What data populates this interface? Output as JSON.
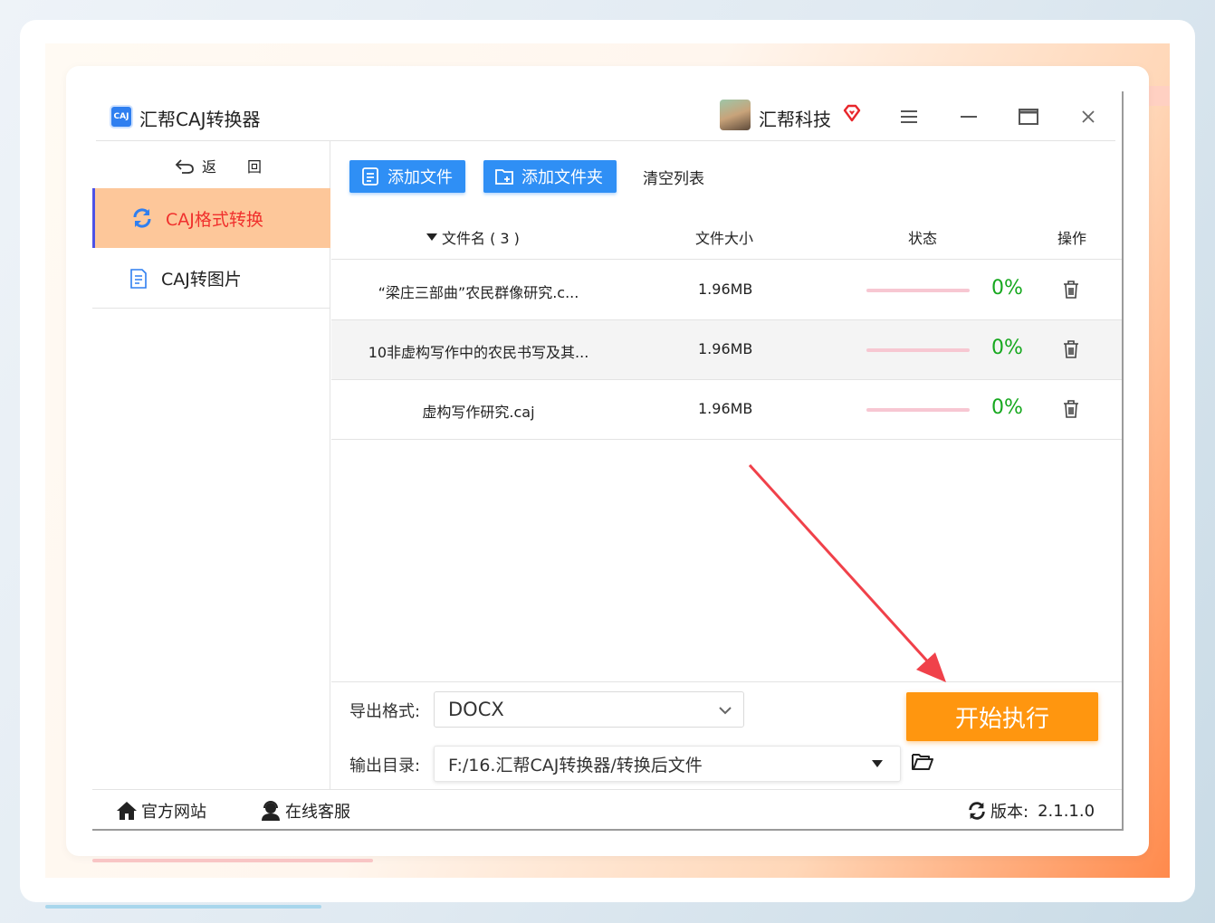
{
  "app": {
    "title": "汇帮CAJ转换器",
    "logo_text": "CAJ",
    "company": "汇帮科技"
  },
  "sidebar": {
    "back_label_1": "返",
    "back_label_2": "回",
    "items": [
      {
        "label": "CAJ格式转换",
        "active": true
      },
      {
        "label": "CAJ转图片",
        "active": false
      }
    ]
  },
  "toolbar": {
    "add_file": "添加文件",
    "add_folder": "添加文件夹",
    "clear_list": "清空列表"
  },
  "table": {
    "col_name": "文件名 ( 3 )",
    "col_size": "文件大小",
    "col_status": "状态",
    "col_ops": "操作",
    "rows": [
      {
        "name": "“梁庄三部曲”农民群像研究.c...",
        "size": "1.96MB",
        "progress": 0,
        "progress_text": "0%"
      },
      {
        "name": "10非虚构写作中的农民书写及其...",
        "size": "1.96MB",
        "progress": 0,
        "progress_text": "0%"
      },
      {
        "name": "虚构写作研究.caj",
        "size": "1.96MB",
        "progress": 0,
        "progress_text": "0%"
      }
    ]
  },
  "settings": {
    "format_label": "导出格式:",
    "format_value": "DOCX",
    "output_label": "输出目录:",
    "output_value": "F:/16.汇帮CAJ转换器/转换后文件",
    "start_button": "开始执行"
  },
  "footer": {
    "official_site": "官方网站",
    "online_service": "在线客服",
    "version_label": "版本:",
    "version_value": "2.1.1.0"
  },
  "colors": {
    "primary_blue": "#2f8ff5",
    "start_orange": "#ff960f",
    "active_nav_bg": "#fdc79a",
    "active_nav_text": "#f0302d",
    "progress_green": "#17a81f",
    "annotation_red": "#f0414a"
  },
  "icons": {
    "logo": "caj-logo-icon",
    "vip": "diamond-heart-icon",
    "menu": "hamburger-icon",
    "minimize": "minimize-icon",
    "maximize": "maximize-icon",
    "close": "close-icon",
    "back": "undo-arrow-icon",
    "convert": "refresh-icon",
    "to_image": "document-icon",
    "add_file": "file-list-icon",
    "add_folder": "folder-plus-icon",
    "sort": "triangle-down-icon",
    "delete": "trash-icon",
    "dropdown": "chevron-down-icon",
    "folder_open": "folder-open-icon",
    "home": "home-icon",
    "service": "user-headset-icon",
    "update": "refresh-icon"
  }
}
